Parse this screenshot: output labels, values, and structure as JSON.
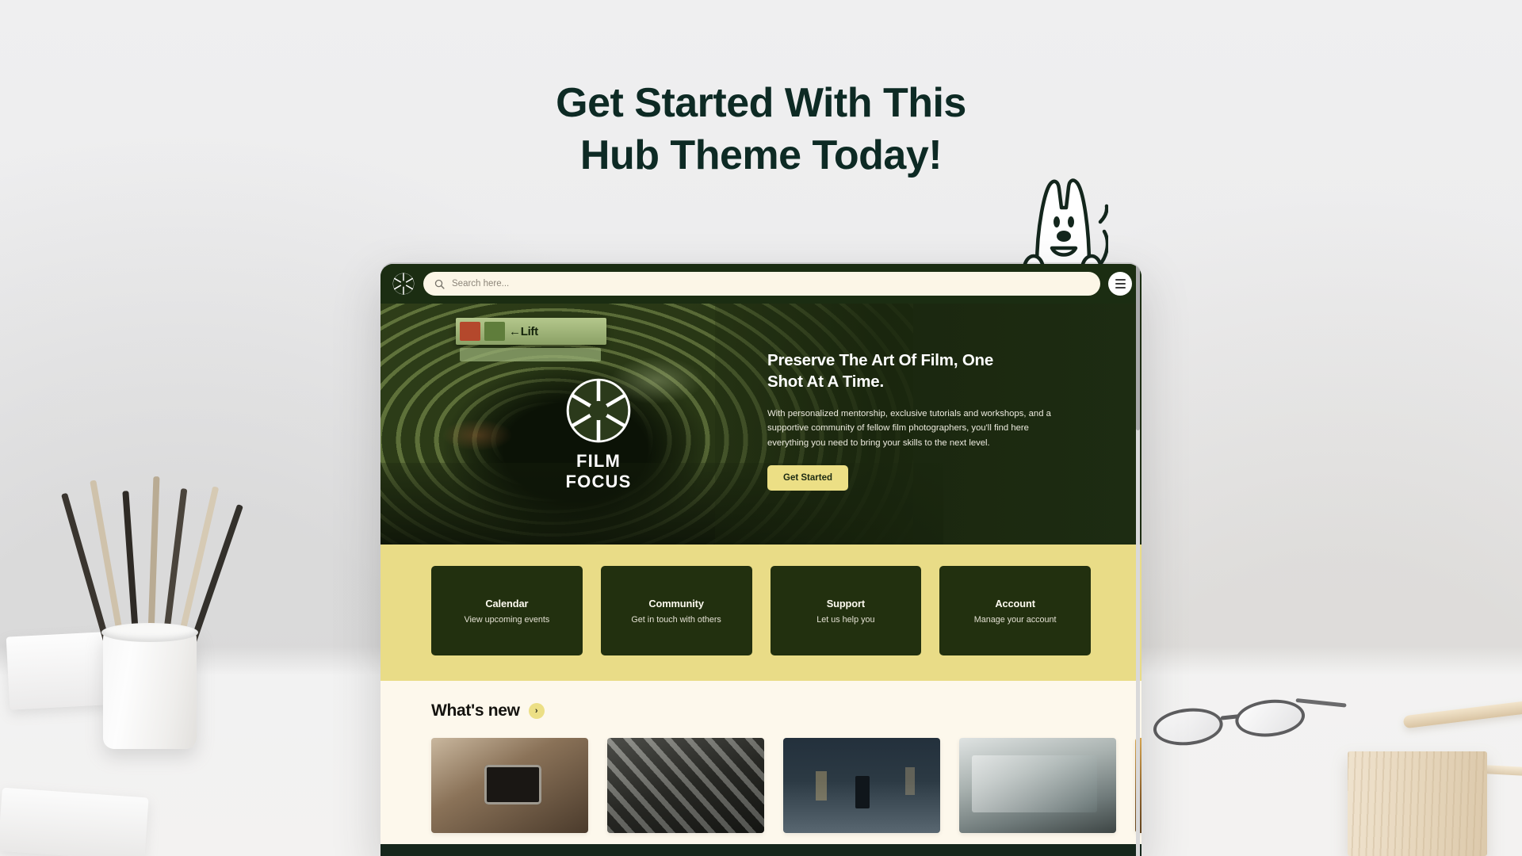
{
  "page": {
    "headline_line1": "Get Started With This",
    "headline_line2": "Hub Theme Today!",
    "headline_color": "#0d2a24",
    "background_description": "white desk with pencil cup, notebooks, glasses and wooden blocks"
  },
  "mascot": {
    "name": "rabbit-mascot",
    "description": "white rabbit character waving over the top of the browser window"
  },
  "browser": {
    "topbar": {
      "logo_icon": "aperture-icon",
      "search": {
        "icon": "search-icon",
        "placeholder": "Search here...",
        "value": ""
      },
      "menu_icon": "hamburger-menu-icon"
    },
    "hero": {
      "background_image": "subway-station-green-tinted",
      "sign_text": "←Lift",
      "logo": {
        "icon": "aperture-icon",
        "wordmark": "FILM FOCUS"
      },
      "heading_line1": "Preserve The Art Of Film, One",
      "heading_line2": "Shot At A Time.",
      "body": "With personalized mentorship, exclusive tutorials and workshops, and a supportive community of fellow film photographers, you'll find here everything you need to bring your skills to the next level.",
      "cta_label": "Get Started",
      "cta_color": "#ecdf85"
    },
    "quicklinks": {
      "band_color": "#e9dc87",
      "tile_color": "#22300f",
      "items": [
        {
          "title": "Calendar",
          "subtitle": "View upcoming events"
        },
        {
          "title": "Community",
          "subtitle": "Get in touch with others"
        },
        {
          "title": "Support",
          "subtitle": "Let us help you"
        },
        {
          "title": "Account",
          "subtitle": "Manage your account"
        }
      ]
    },
    "whats_new": {
      "title": "What's new",
      "chevron_icon": "chevron-right-icon",
      "next_icon": "arrow-right-icon",
      "cards": [
        {
          "alt": "person holding a vintage film camera to their face"
        },
        {
          "alt": "pile of black and white vintage cameras"
        },
        {
          "alt": "person walking on a wet city street at night"
        },
        {
          "alt": "reflection in a shop window on a street"
        },
        {
          "alt": "warm interior with window light"
        }
      ]
    }
  }
}
